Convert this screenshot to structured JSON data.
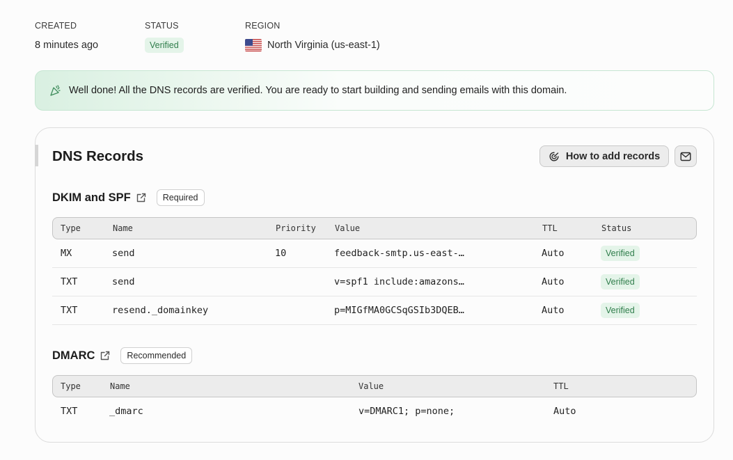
{
  "meta": {
    "created": {
      "label": "CREATED",
      "value": "8 minutes ago"
    },
    "status": {
      "label": "STATUS",
      "value": "Verified"
    },
    "region": {
      "label": "REGION",
      "value": "North Virginia (us-east-1)",
      "flag_icon": "us-flag-icon"
    }
  },
  "banner": {
    "icon": "party-popper-icon",
    "text": "Well done! All the DNS records are verified. You are ready to start building and sending emails with this domain."
  },
  "dns": {
    "title": "DNS Records",
    "how_to_button": "How to add records",
    "how_to_icon": "brain-icon",
    "mail_icon": "mail-icon",
    "dkim_spf": {
      "title": "DKIM and SPF",
      "tag": "Required",
      "columns": [
        "Type",
        "Name",
        "Priority",
        "Value",
        "TTL",
        "Status"
      ],
      "rows": [
        {
          "type": "MX",
          "name": "send",
          "priority": "10",
          "value": "feedback-smtp.us-east-…",
          "ttl": "Auto",
          "status": "Verified"
        },
        {
          "type": "TXT",
          "name": "send",
          "priority": "",
          "value": "v=spf1 include:amazons…",
          "ttl": "Auto",
          "status": "Verified"
        },
        {
          "type": "TXT",
          "name": "resend._domainkey",
          "priority": "",
          "value": "p=MIGfMA0GCSqGSIb3DQEB…",
          "ttl": "Auto",
          "status": "Verified"
        }
      ]
    },
    "dmarc": {
      "title": "DMARC",
      "tag": "Recommended",
      "columns": [
        "Type",
        "Name",
        "Value",
        "TTL"
      ],
      "rows": [
        {
          "type": "TXT",
          "name": "_dmarc",
          "value": "v=DMARC1; p=none;",
          "ttl": "Auto"
        }
      ]
    }
  },
  "colors": {
    "verified_bg": "#e4f4e9",
    "verified_fg": "#2f7d4b",
    "banner_border": "#c6e6d2"
  }
}
